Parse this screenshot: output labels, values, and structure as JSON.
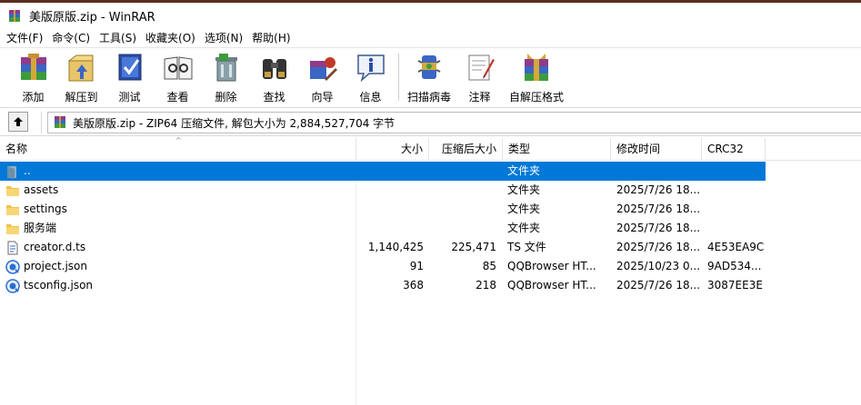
{
  "window": {
    "title": "美版原版.zip - WinRAR"
  },
  "menu": [
    {
      "label": "文件(F)"
    },
    {
      "label": "命令(C)"
    },
    {
      "label": "工具(S)"
    },
    {
      "label": "收藏夹(O)"
    },
    {
      "label": "选项(N)"
    },
    {
      "label": "帮助(H)"
    }
  ],
  "toolbar": [
    {
      "label": "添加",
      "icon": "add-archive-icon"
    },
    {
      "label": "解压到",
      "icon": "extract-to-icon"
    },
    {
      "label": "测试",
      "icon": "test-icon"
    },
    {
      "label": "查看",
      "icon": "view-icon"
    },
    {
      "label": "删除",
      "icon": "delete-icon"
    },
    {
      "label": "查找",
      "icon": "find-icon"
    },
    {
      "label": "向导",
      "icon": "wizard-icon"
    },
    {
      "label": "信息",
      "icon": "info-icon"
    },
    {
      "label": "扫描病毒",
      "icon": "virus-scan-icon"
    },
    {
      "label": "注释",
      "icon": "comment-icon"
    },
    {
      "label": "自解压格式",
      "icon": "sfx-icon"
    }
  ],
  "address": {
    "text": "美版原版.zip - ZIP64 压缩文件, 解包大小为 2,884,527,704 字节"
  },
  "columns": {
    "name": "名称",
    "size": "大小",
    "packed": "压缩后大小",
    "type": "类型",
    "modified": "修改时间",
    "crc": "CRC32"
  },
  "files": [
    {
      "name": "..",
      "size": "",
      "packed": "",
      "type": "文件夹",
      "modified": "",
      "crc": "",
      "icon": "parent-folder-icon",
      "selected": true
    },
    {
      "name": "assets",
      "size": "",
      "packed": "",
      "type": "文件夹",
      "modified": "2025/7/26 18...",
      "crc": "",
      "icon": "folder-icon"
    },
    {
      "name": "settings",
      "size": "",
      "packed": "",
      "type": "文件夹",
      "modified": "2025/7/26 18...",
      "crc": "",
      "icon": "folder-icon"
    },
    {
      "name": "服务端",
      "size": "",
      "packed": "",
      "type": "文件夹",
      "modified": "2025/7/26 18...",
      "crc": "",
      "icon": "folder-icon"
    },
    {
      "name": "creator.d.ts",
      "size": "1,140,425",
      "packed": "225,471",
      "type": "TS 文件",
      "modified": "2025/7/26 18...",
      "crc": "4E53EA9C",
      "icon": "ts-file-icon"
    },
    {
      "name": "project.json",
      "size": "91",
      "packed": "85",
      "type": "QQBrowser HT...",
      "modified": "2025/10/23 0...",
      "crc": "9AD534...",
      "icon": "browser-file-icon"
    },
    {
      "name": "tsconfig.json",
      "size": "368",
      "packed": "218",
      "type": "QQBrowser HT...",
      "modified": "2025/7/26 18...",
      "crc": "3087EE3E",
      "icon": "browser-file-icon"
    }
  ],
  "colors": {
    "selection": "#0078d7",
    "folder": "#f4c24a"
  }
}
